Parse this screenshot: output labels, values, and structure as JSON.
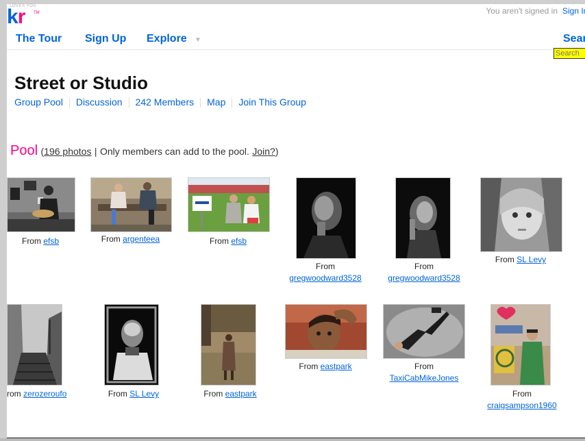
{
  "header": {
    "logo_small": "LOVES YOU",
    "logo_tm": "TM",
    "signed_text": "You aren't signed in",
    "signin_label": "Sign In"
  },
  "nav": {
    "tour": "The Tour",
    "signup": "Sign Up",
    "explore": "Explore",
    "caret": "▼",
    "search": "Search",
    "search_placeholder": "Search"
  },
  "group": {
    "title": "Street or Studio",
    "subnav": [
      "Group Pool",
      "Discussion",
      "242 Members",
      "Map",
      "Join This Group"
    ]
  },
  "pool": {
    "title": "Pool",
    "open": "(",
    "photos_link": "196 photos",
    "separator": "|",
    "only_members": "Only members can add to the pool.",
    "join": "Join?",
    "close": ")"
  },
  "from_label": "From",
  "photos": [
    {
      "author": "efsb"
    },
    {
      "author": "argenteea"
    },
    {
      "author": "efsb"
    },
    {
      "author": "gregwoodward3528"
    },
    {
      "author": "gregwoodward3528"
    },
    {
      "author": "SL Levy"
    },
    {
      "author": "zerozeroufo",
      "from_text": "rom"
    },
    {
      "author": "SL Levy"
    },
    {
      "author": "eastpark"
    },
    {
      "author": "eastpark"
    },
    {
      "author": "TaxiCabMikeJones"
    },
    {
      "author": "craigsampson1960"
    }
  ],
  "colors": {
    "link": "#0063dc",
    "brand_pink": "#ff0084",
    "search_highlight": "#ffff00"
  }
}
